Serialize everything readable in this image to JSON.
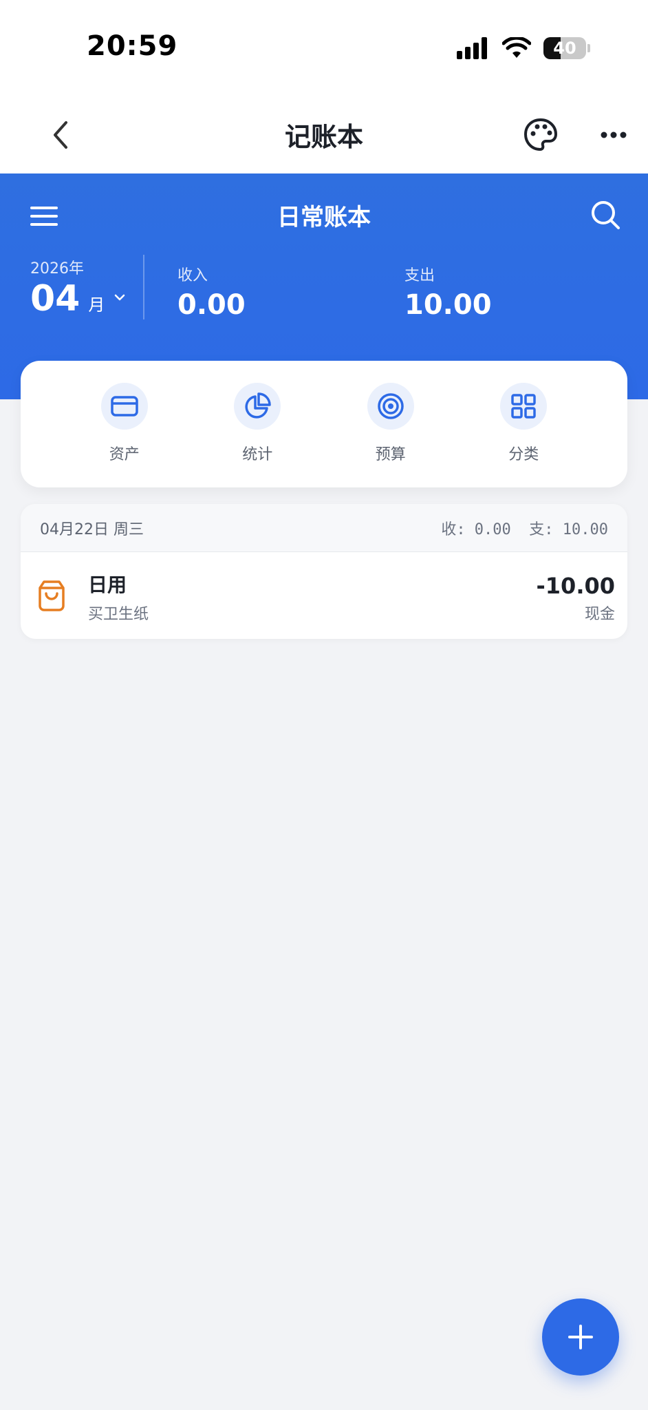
{
  "status_bar": {
    "time": "20:59",
    "battery": "40",
    "battery_level": 0.4
  },
  "nav": {
    "title": "记账本"
  },
  "header": {
    "book_title": "日常账本",
    "year": "2026年",
    "month": "04",
    "month_suffix": "月",
    "income_label": "收入",
    "income_value": "0.00",
    "expense_label": "支出",
    "expense_value": "10.00"
  },
  "quick_menu": [
    {
      "label": "资产",
      "icon": "wallet-card-icon"
    },
    {
      "label": "统计",
      "icon": "pie-chart-icon"
    },
    {
      "label": "预算",
      "icon": "target-icon"
    },
    {
      "label": "分类",
      "icon": "grid-icon"
    }
  ],
  "transactions": {
    "date": "04月22日 周三",
    "summary": "收: 0.00  支: 10.00",
    "rows": [
      {
        "category": "日用",
        "note": "买卫生纸",
        "amount": "-10.00",
        "account": "现金",
        "icon": "shopping-bag-icon"
      }
    ]
  },
  "colors": {
    "primary": "#2d6ae6",
    "category_orange": "#e67e22",
    "page_bg": "#f2f3f6"
  }
}
